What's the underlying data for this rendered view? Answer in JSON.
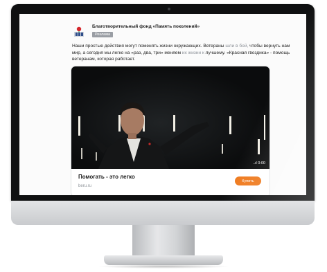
{
  "post": {
    "org_name": "Благотворительный фонд «Память поколений»",
    "ad_label": "Реклама",
    "text_1": "Наши простые действия могут поменять жизни окружающих. Ветераны ",
    "text_muted_1": "шли в бой,",
    "text_2": " чтобы вернуть нам мир, а сегодня мы легко на «раз, два, три» меняем ",
    "text_muted_2": "их жизни к",
    "text_3": " лучшему. «Красная гвоздика» - помощь ветеранам, которая работает."
  },
  "card": {
    "title": "Помогать - это легко",
    "domain": "beru.ru",
    "cta_label": "Купить",
    "video_indicator": "..ıl 0:00"
  },
  "colors": {
    "accent": "#ef7a1e",
    "badge": "#9a9ea4",
    "bezel": "#0f1011"
  },
  "icons": {
    "logo": "carnation-logo-icon",
    "signal": "signal-icon"
  }
}
